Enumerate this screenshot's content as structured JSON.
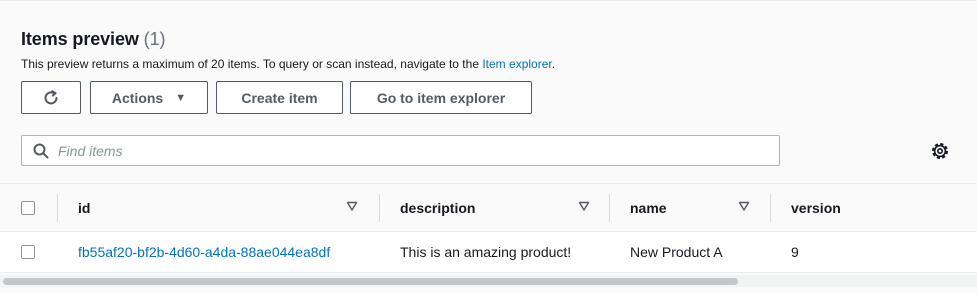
{
  "header": {
    "title": "Items preview",
    "count": "(1)",
    "description": "This preview returns a maximum of 20 items. To query or scan instead, navigate to the",
    "description_link": "Item explorer",
    "description_end": "."
  },
  "toolbar": {
    "refresh_icon": "refresh-icon",
    "actions_label": "Actions",
    "create_item_label": "Create item",
    "go_to_explorer_label": "Go to item explorer"
  },
  "search": {
    "placeholder": "Find items",
    "value": ""
  },
  "table": {
    "columns": [
      "id",
      "description",
      "name",
      "version"
    ],
    "rows": [
      {
        "id": "fb55af20-bf2b-4d60-a4da-88ae044ea8df",
        "description": "This is an amazing product!",
        "name": "New Product A",
        "version": "9"
      }
    ]
  },
  "colors": {
    "link": "#0073bb",
    "button_border": "#545b64",
    "text": "#16191f"
  }
}
